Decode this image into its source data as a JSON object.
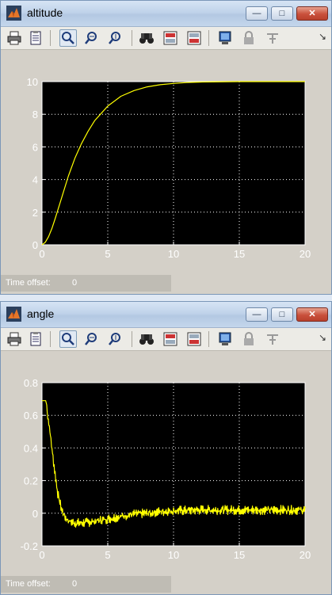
{
  "windows": [
    {
      "title": "altitude",
      "status": {
        "label": "Time offset:",
        "value": "0"
      },
      "chart_data": {
        "type": "line",
        "title": "",
        "xlabel": "",
        "ylabel": "",
        "xlim": [
          0,
          20
        ],
        "ylim": [
          0,
          10
        ],
        "xticks": [
          0,
          5,
          10,
          15,
          20
        ],
        "yticks": [
          0,
          2,
          4,
          6,
          8,
          10
        ],
        "grid": true,
        "background": "#000000",
        "series": [
          {
            "color": "#ffff00",
            "x": [
              0,
              0.25,
              0.5,
              0.75,
              1,
              1.5,
              2,
              2.5,
              3,
              3.5,
              4,
              5,
              6,
              7,
              8,
              9,
              10,
              11,
              12,
              13,
              15,
              17.5,
              20
            ],
            "y": [
              0,
              0.15,
              0.5,
              1.0,
              1.6,
              2.9,
              4.2,
              5.3,
              6.2,
              6.95,
              7.6,
              8.5,
              9.1,
              9.45,
              9.68,
              9.81,
              9.89,
              9.94,
              9.97,
              9.98,
              10.0,
              10.0,
              10.0
            ]
          }
        ]
      }
    },
    {
      "title": "angle",
      "status": {
        "label": "Time offset:",
        "value": "0"
      },
      "chart_data": {
        "type": "line",
        "title": "",
        "xlabel": "",
        "ylabel": "",
        "xlim": [
          0,
          20
        ],
        "ylim": [
          -0.2,
          0.8
        ],
        "xticks": [
          0,
          5,
          10,
          15,
          20
        ],
        "yticks": [
          -0.2,
          0,
          0.2,
          0.4,
          0.6,
          0.8
        ],
        "ytick_labels": [
          "-0.2",
          "0",
          "0.2",
          "0.4",
          "0.6",
          "0.8"
        ],
        "grid": true,
        "background": "#000000",
        "series": [
          {
            "color": "#ffff00",
            "noisy": true,
            "x": [
              0,
              0.3,
              0.6,
              0.9,
              1.2,
              1.5,
              1.8,
              2.1,
              2.5,
              3,
              4,
              5,
              6,
              7,
              8,
              9,
              10,
              12,
              14,
              16,
              18,
              20
            ],
            "y": [
              0.69,
              0.69,
              0.5,
              0.3,
              0.12,
              0.02,
              -0.03,
              -0.05,
              -0.06,
              -0.06,
              -0.05,
              -0.035,
              -0.02,
              -0.005,
              0.0,
              0.01,
              0.015,
              0.02,
              0.02,
              0.02,
              0.02,
              0.02
            ]
          }
        ]
      }
    }
  ],
  "toolbar": {
    "icons": [
      "print-icon",
      "parameters-icon",
      "zoom-icon",
      "zoom-x-icon",
      "zoom-y-icon",
      "autoscale-icon",
      "save-axes-icon",
      "restore-axes-icon",
      "floating-scope-icon",
      "lock-axes-icon",
      "signal-selection-icon",
      "toolbar-overflow-icon"
    ]
  },
  "colors": {
    "titlebar": "#c4d6ec",
    "plot_bg": "#000000",
    "trace": "#ffff00",
    "frame": "#d4d0c8",
    "status_bar": "#bfbcb4"
  }
}
